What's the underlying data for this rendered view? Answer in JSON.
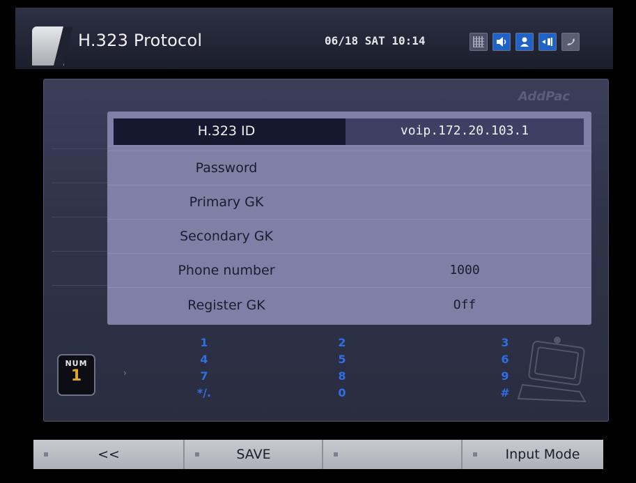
{
  "header": {
    "title": "H.323 Protocol",
    "datetime": "06/18 SAT 10:14",
    "status_icons": [
      "grid-icon",
      "speaker-icon",
      "user-icon",
      "network-icon",
      "phone-icon"
    ]
  },
  "brand": "AddPac",
  "settings": [
    {
      "label": "H.323 ID",
      "value": "voip.172.20.103.1",
      "selected": true
    },
    {
      "label": "Password",
      "value": ""
    },
    {
      "label": "Primary GK",
      "value": ""
    },
    {
      "label": "Secondary GK",
      "value": ""
    },
    {
      "label": "Phone number",
      "value": "1000"
    },
    {
      "label": "Register GK",
      "value": "Off"
    }
  ],
  "input_mode": {
    "badge_top": "NUM",
    "badge_num": "1",
    "arrow": "›"
  },
  "keypad": {
    "col1": [
      "1",
      "4",
      "7",
      "*/."
    ],
    "col2": [
      "2",
      "5",
      "8",
      "0"
    ],
    "col3": [
      "3",
      "6",
      "9",
      "#"
    ]
  },
  "softkeys": {
    "back": "<<",
    "save": "SAVE",
    "blank": "",
    "input_mode": "Input Mode"
  },
  "colors": {
    "accent_blue": "#1f63c8",
    "keypad_blue": "#2f6fe3",
    "badge_gold": "#e0a92a",
    "selected_row": "#161830"
  }
}
